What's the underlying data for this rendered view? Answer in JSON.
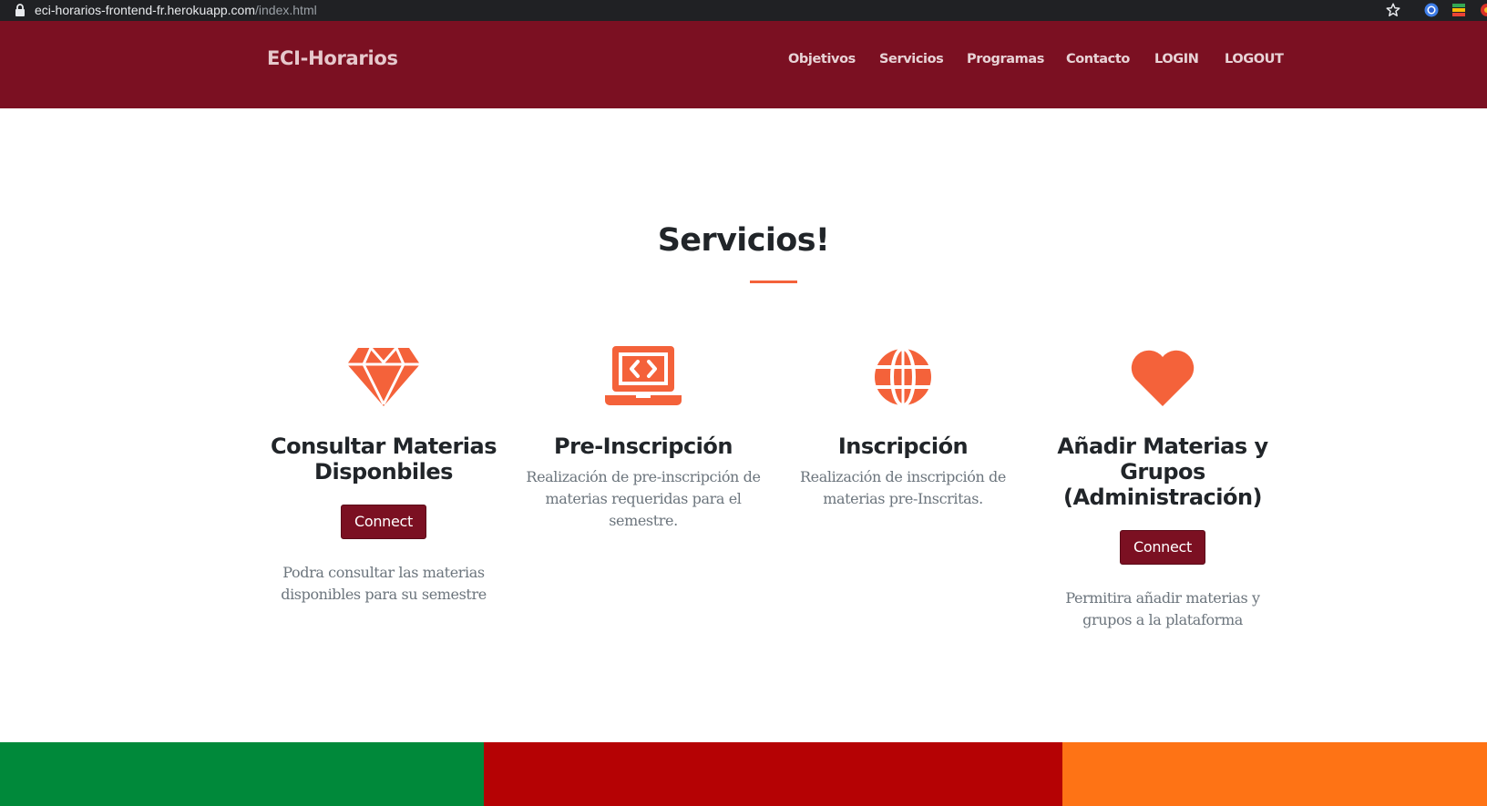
{
  "browser": {
    "url_host": "eci-horarios-frontend-fr.herokuapp.com",
    "url_path": "/index.html",
    "icons": [
      "lock-icon",
      "star-icon",
      "extension-icon",
      "extension-icon",
      "extension-icon"
    ]
  },
  "navbar": {
    "brand": "ECI-Horarios",
    "items": [
      {
        "label": "Objetivos"
      },
      {
        "label": "Servicios"
      },
      {
        "label": "Programas"
      },
      {
        "label": "Contacto"
      },
      {
        "label": "LOGIN"
      },
      {
        "label": "LOGOUT"
      }
    ]
  },
  "services_section": {
    "title": "Servicios!",
    "cards": [
      {
        "icon": "gem-icon",
        "title": "Consultar Materias Disponbiles",
        "button": "Connect",
        "description": "Podra consultar las materias disponibles para su semestre"
      },
      {
        "icon": "laptop-code-icon",
        "title": "Pre-Inscripción",
        "description": "Realización de pre-inscripción de materias requeridas para el semestre."
      },
      {
        "icon": "globe-icon",
        "title": "Inscripción",
        "description": "Realización de inscripción de materias pre-Inscritas."
      },
      {
        "icon": "heart-icon",
        "title": "Añadir Materias y Grupos (Administración)",
        "button": "Connect",
        "description": "Permitira añadir materias y grupos a la plataforma"
      }
    ]
  },
  "colors": {
    "navbar": "#7b1022",
    "accent": "#f4623a",
    "band_green": "#00893a",
    "band_red": "#b50204",
    "band_orange": "#fe7315"
  }
}
